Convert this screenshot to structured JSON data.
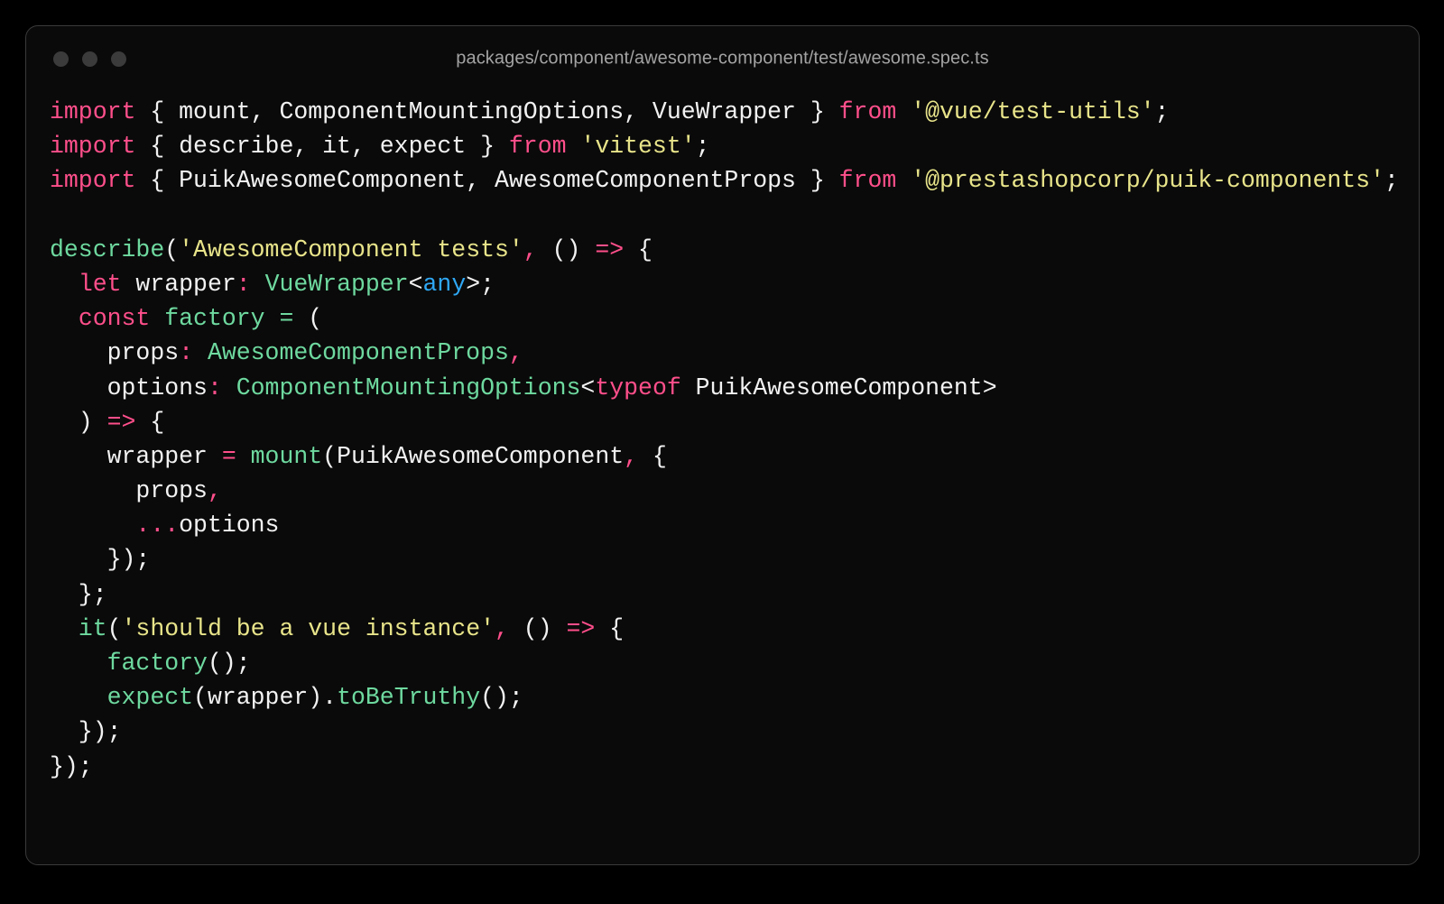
{
  "window": {
    "title": "packages/component/awesome-component/test/awesome.spec.ts",
    "dots": [
      "window-dot-close",
      "window-dot-minimize",
      "window-dot-maximize"
    ],
    "background": "#0a0a0a",
    "border_color": "#3a3a3a",
    "dot_color": "#3b3b3b",
    "title_color": "#a3a3a3"
  },
  "theme": {
    "keyword": "#ff4f8b",
    "string": "#e8e48a",
    "function": "#6ed99f",
    "type": "#6ed99f",
    "plain": "#f2f2f2",
    "builtin": "#2fa8f5",
    "operator": "#ff4f8b",
    "assign": "#6ed99f"
  },
  "code": {
    "language": "typescript",
    "plain_text": "import { mount, ComponentMountingOptions, VueWrapper } from '@vue/test-utils';\nimport { describe, it, expect } from 'vitest';\nimport { PuikAwesomeComponent, AwesomeComponentProps } from '@prestashopcorp/puik-components';\n\ndescribe('AwesomeComponent tests', () => {\n  let wrapper: VueWrapper<any>;\n  const factory = (\n    props: AwesomeComponentProps,\n    options: ComponentMountingOptions<typeof PuikAwesomeComponent>\n  ) => {\n    wrapper = mount(PuikAwesomeComponent, {\n      props,\n      ...options\n    });\n  };\n  it('should be a vue instance', () => {\n    factory();\n    expect(wrapper).toBeTruthy();\n  });\n});",
    "lines": [
      {
        "n": 1,
        "tokens": [
          {
            "t": "import",
            "c": "kw"
          },
          {
            "t": " { mount, ComponentMountingOptions, VueWrapper } ",
            "c": "plain"
          },
          {
            "t": "from",
            "c": "kw"
          },
          {
            "t": " ",
            "c": "plain"
          },
          {
            "t": "'@vue/test-utils'",
            "c": "str"
          },
          {
            "t": ";",
            "c": "punct"
          }
        ]
      },
      {
        "n": 2,
        "tokens": [
          {
            "t": "import",
            "c": "kw"
          },
          {
            "t": " { describe, it, expect } ",
            "c": "plain"
          },
          {
            "t": "from",
            "c": "kw"
          },
          {
            "t": " ",
            "c": "plain"
          },
          {
            "t": "'vitest'",
            "c": "str"
          },
          {
            "t": ";",
            "c": "punct"
          }
        ]
      },
      {
        "n": 3,
        "tokens": [
          {
            "t": "import",
            "c": "kw"
          },
          {
            "t": " { PuikAwesomeComponent, AwesomeComponentProps } ",
            "c": "plain"
          },
          {
            "t": "from",
            "c": "kw"
          },
          {
            "t": " ",
            "c": "plain"
          },
          {
            "t": "'@prestashopcorp/puik-components'",
            "c": "str"
          },
          {
            "t": ";",
            "c": "punct"
          }
        ]
      },
      {
        "n": 4,
        "tokens": [
          {
            "t": "",
            "c": "plain"
          }
        ]
      },
      {
        "n": 5,
        "tokens": [
          {
            "t": "describe",
            "c": "fn"
          },
          {
            "t": "(",
            "c": "punct"
          },
          {
            "t": "'AwesomeComponent tests'",
            "c": "str"
          },
          {
            "t": ",",
            "c": "op"
          },
          {
            "t": " () ",
            "c": "punct"
          },
          {
            "t": "=>",
            "c": "op"
          },
          {
            "t": " {",
            "c": "punct"
          }
        ]
      },
      {
        "n": 6,
        "tokens": [
          {
            "t": "  ",
            "c": "plain"
          },
          {
            "t": "let",
            "c": "kw"
          },
          {
            "t": " wrapper",
            "c": "plain"
          },
          {
            "t": ":",
            "c": "op"
          },
          {
            "t": " ",
            "c": "plain"
          },
          {
            "t": "VueWrapper",
            "c": "type"
          },
          {
            "t": "<",
            "c": "punct"
          },
          {
            "t": "any",
            "c": "builtin"
          },
          {
            "t": ">;",
            "c": "punct"
          }
        ]
      },
      {
        "n": 7,
        "tokens": [
          {
            "t": "  ",
            "c": "plain"
          },
          {
            "t": "const",
            "c": "kw"
          },
          {
            "t": " ",
            "c": "plain"
          },
          {
            "t": "factory",
            "c": "fn"
          },
          {
            "t": " ",
            "c": "plain"
          },
          {
            "t": "=",
            "c": "eq"
          },
          {
            "t": " (",
            "c": "punct"
          }
        ]
      },
      {
        "n": 8,
        "tokens": [
          {
            "t": "    props",
            "c": "plain"
          },
          {
            "t": ":",
            "c": "op"
          },
          {
            "t": " ",
            "c": "plain"
          },
          {
            "t": "AwesomeComponentProps",
            "c": "type"
          },
          {
            "t": ",",
            "c": "op"
          }
        ]
      },
      {
        "n": 9,
        "tokens": [
          {
            "t": "    options",
            "c": "plain"
          },
          {
            "t": ":",
            "c": "op"
          },
          {
            "t": " ",
            "c": "plain"
          },
          {
            "t": "ComponentMountingOptions",
            "c": "type"
          },
          {
            "t": "<",
            "c": "punct"
          },
          {
            "t": "typeof",
            "c": "kw"
          },
          {
            "t": " PuikAwesomeComponent>",
            "c": "plain"
          }
        ]
      },
      {
        "n": 10,
        "tokens": [
          {
            "t": "  )",
            "c": "punct"
          },
          {
            "t": " ",
            "c": "plain"
          },
          {
            "t": "=>",
            "c": "op"
          },
          {
            "t": " {",
            "c": "punct"
          }
        ]
      },
      {
        "n": 11,
        "tokens": [
          {
            "t": "    wrapper",
            "c": "plain"
          },
          {
            "t": " ",
            "c": "plain"
          },
          {
            "t": "=",
            "c": "op"
          },
          {
            "t": " ",
            "c": "plain"
          },
          {
            "t": "mount",
            "c": "fn"
          },
          {
            "t": "(PuikAwesomeComponent",
            "c": "plain"
          },
          {
            "t": ",",
            "c": "op"
          },
          {
            "t": " {",
            "c": "punct"
          }
        ]
      },
      {
        "n": 12,
        "tokens": [
          {
            "t": "      props",
            "c": "plain"
          },
          {
            "t": ",",
            "c": "op"
          }
        ]
      },
      {
        "n": 13,
        "tokens": [
          {
            "t": "      ",
            "c": "plain"
          },
          {
            "t": "...",
            "c": "op"
          },
          {
            "t": "options",
            "c": "plain"
          }
        ]
      },
      {
        "n": 14,
        "tokens": [
          {
            "t": "    });",
            "c": "punct"
          }
        ]
      },
      {
        "n": 15,
        "tokens": [
          {
            "t": "  };",
            "c": "punct"
          }
        ]
      },
      {
        "n": 16,
        "tokens": [
          {
            "t": "  ",
            "c": "plain"
          },
          {
            "t": "it",
            "c": "fn"
          },
          {
            "t": "(",
            "c": "punct"
          },
          {
            "t": "'should be a vue instance'",
            "c": "str"
          },
          {
            "t": ",",
            "c": "op"
          },
          {
            "t": " () ",
            "c": "punct"
          },
          {
            "t": "=>",
            "c": "op"
          },
          {
            "t": " {",
            "c": "punct"
          }
        ]
      },
      {
        "n": 17,
        "tokens": [
          {
            "t": "    ",
            "c": "plain"
          },
          {
            "t": "factory",
            "c": "fn"
          },
          {
            "t": "();",
            "c": "punct"
          }
        ]
      },
      {
        "n": 18,
        "tokens": [
          {
            "t": "    ",
            "c": "plain"
          },
          {
            "t": "expect",
            "c": "fn"
          },
          {
            "t": "(wrapper).",
            "c": "plain"
          },
          {
            "t": "toBeTruthy",
            "c": "fn"
          },
          {
            "t": "();",
            "c": "punct"
          }
        ]
      },
      {
        "n": 19,
        "tokens": [
          {
            "t": "  });",
            "c": "punct"
          }
        ]
      },
      {
        "n": 20,
        "tokens": [
          {
            "t": "});",
            "c": "punct"
          }
        ]
      }
    ]
  }
}
